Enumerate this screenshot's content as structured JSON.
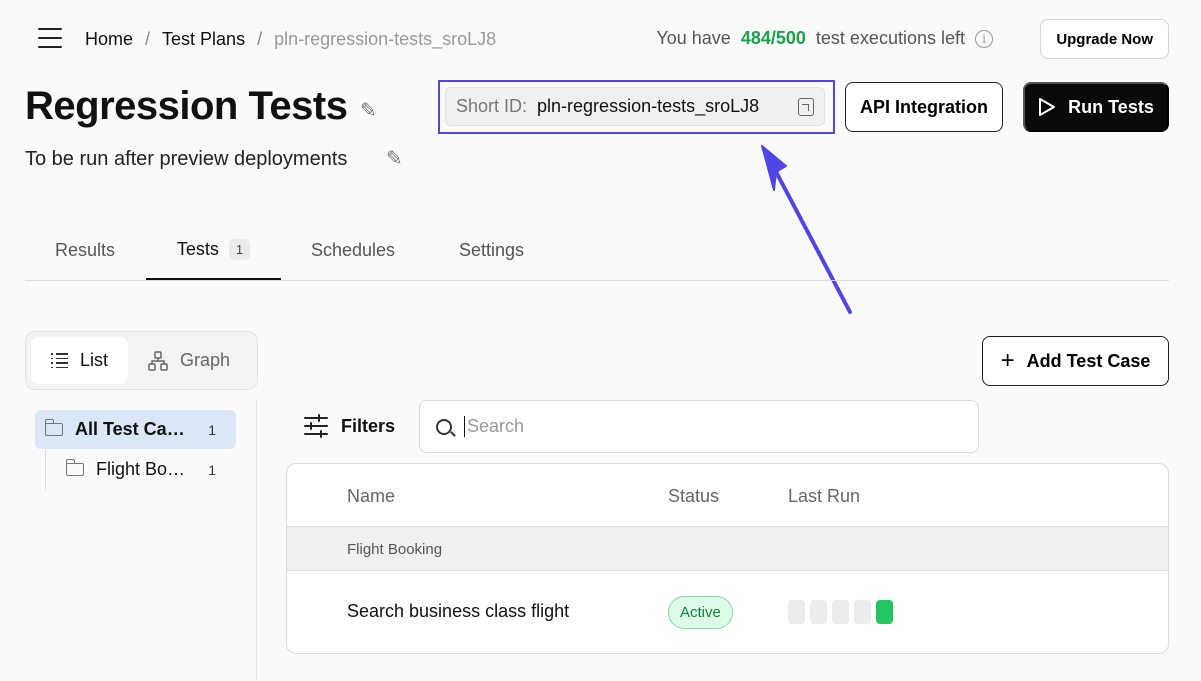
{
  "header": {
    "breadcrumb": [
      {
        "label": "Home"
      },
      {
        "label": "Test Plans"
      },
      {
        "label": "pln-regression-tests_sroLJ8"
      }
    ],
    "quota_prefix": "You have",
    "quota_count": "484/500",
    "quota_suffix": "test executions left",
    "upgrade_label": "Upgrade Now"
  },
  "plan": {
    "title": "Regression Tests",
    "description": "To be run after preview deployments",
    "short_id_label": "Short ID:",
    "short_id_value": "pln-regression-tests_sroLJ8"
  },
  "actions": {
    "api_label": "API Integration",
    "run_label": "Run Tests"
  },
  "tabs": [
    {
      "label": "Results"
    },
    {
      "label": "Tests",
      "count": "1"
    },
    {
      "label": "Schedules"
    },
    {
      "label": "Settings"
    }
  ],
  "view_toggle": {
    "list_label": "List",
    "graph_label": "Graph"
  },
  "add_test_case_label": "Add Test Case",
  "tree": {
    "root": {
      "label": "All Test Cases",
      "count": "1"
    },
    "children": [
      {
        "label": "Flight Booking",
        "count": "1"
      }
    ]
  },
  "filters_label": "Filters",
  "search": {
    "placeholder": "Search",
    "value": ""
  },
  "table": {
    "columns": [
      "Name",
      "Status",
      "Last Run"
    ],
    "groups": [
      {
        "name": "Flight Booking",
        "rows": [
          {
            "name": "Search business class flight",
            "status": "Active",
            "last_runs": [
              "none",
              "none",
              "none",
              "none",
              "pass"
            ]
          }
        ]
      }
    ]
  },
  "colors": {
    "accent": "#4f46e5",
    "quota": "#16a34a",
    "status_active_bg": "#dcfce7",
    "status_active_text": "#15803d",
    "run_pass": "#22c55e",
    "run_none": "#ececec",
    "selected_tree_bg": "#dbe6f7"
  },
  "icons": [
    "menu-icon",
    "info-icon",
    "pencil-icon",
    "copy-icon",
    "play-icon",
    "list-icon",
    "graph-icon",
    "plus-icon",
    "folder-icon",
    "filters-icon",
    "search-icon",
    "annotation-arrow"
  ]
}
